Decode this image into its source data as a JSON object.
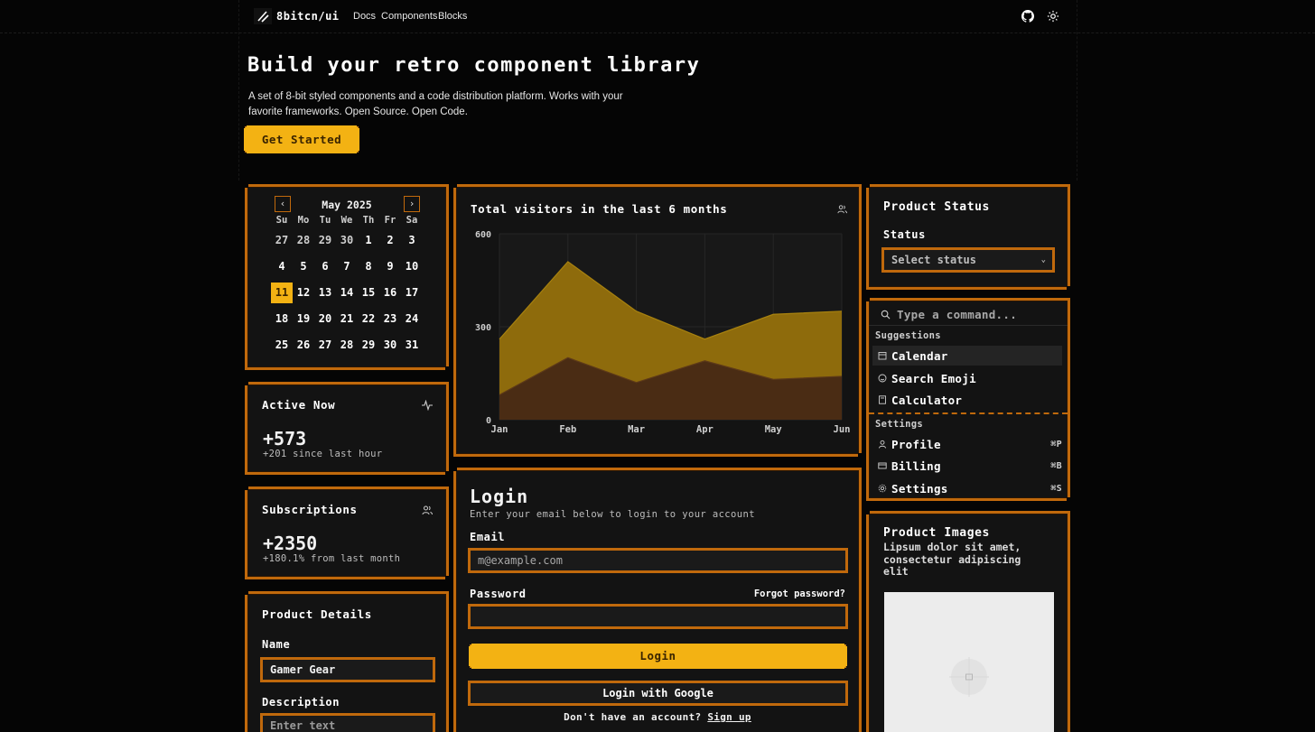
{
  "nav": {
    "brand": "8bitcn/ui",
    "links": [
      "Docs",
      "Components",
      "Blocks"
    ],
    "icons": [
      "github-icon",
      "sun-icon"
    ]
  },
  "hero": {
    "title": "Build your retro component library",
    "description": "A set of 8-bit styled components and a code distribution platform. Works with your favorite frameworks. Open Source. Open Code.",
    "cta": "Get Started"
  },
  "calendar": {
    "month_label": "May 2025",
    "prev_icon": "‹",
    "next_icon": "›",
    "weekdays": [
      "Su",
      "Mo",
      "Tu",
      "We",
      "Th",
      "Fr",
      "Sa"
    ],
    "weeks": [
      [
        "27",
        "28",
        "29",
        "30",
        "1",
        "2",
        "3"
      ],
      [
        "4",
        "5",
        "6",
        "7",
        "8",
        "9",
        "10"
      ],
      [
        "11",
        "12",
        "13",
        "14",
        "15",
        "16",
        "17"
      ],
      [
        "18",
        "19",
        "20",
        "21",
        "22",
        "23",
        "24"
      ],
      [
        "25",
        "26",
        "27",
        "28",
        "29",
        "30",
        "31"
      ]
    ],
    "selected": "11"
  },
  "active_now": {
    "title": "Active Now",
    "value": "+573",
    "sub": "+201 since last hour",
    "icon": "activity-icon"
  },
  "subscriptions": {
    "title": "Subscriptions",
    "value": "+2350",
    "sub": "+180.1% from last month",
    "icon": "users-icon"
  },
  "product_details": {
    "title": "Product Details",
    "name_label": "Name",
    "name_value": "Gamer Gear",
    "description_label": "Description",
    "description_placeholder": "Enter text"
  },
  "visitors_chart": {
    "title": "Total visitors in the last 6 months",
    "icon": "users-icon"
  },
  "chart_data": {
    "type": "area",
    "title": "Total visitors in the last 6 months",
    "categories": [
      "Jan",
      "Feb",
      "Mar",
      "Apr",
      "May",
      "Jun"
    ],
    "series": [
      {
        "values": [
          80,
          200,
          120,
          190,
          130,
          140
        ]
      },
      {
        "values": [
          260,
          510,
          350,
          260,
          340,
          350
        ]
      }
    ],
    "ylim": [
      0,
      600
    ],
    "yticks": [
      "0",
      "300",
      "600"
    ],
    "grid": true,
    "colors": [
      "#4a2c14",
      "#8e6b0c"
    ]
  },
  "login": {
    "title": "Login",
    "subtitle": "Enter your email below to login to your account",
    "email_label": "Email",
    "email_placeholder": "m@example.com",
    "password_label": "Password",
    "forgot": "Forgot password?",
    "login_button": "Login",
    "google_button": "Login with Google",
    "no_account": "Don't have an account?",
    "signup": "Sign up"
  },
  "product_status": {
    "title": "Product Status",
    "status_label": "Status",
    "select_placeholder": "Select status"
  },
  "command": {
    "placeholder": "Type a command...",
    "suggestions_heading": "Suggestions",
    "suggestions": [
      {
        "label": "Calendar",
        "icon": "calendar-icon"
      },
      {
        "label": "Search Emoji",
        "icon": "smile-icon"
      },
      {
        "label": "Calculator",
        "icon": "calculator-icon"
      }
    ],
    "settings_heading": "Settings",
    "settings": [
      {
        "label": "Profile",
        "icon": "user-icon",
        "shortcut": "⌘P"
      },
      {
        "label": "Billing",
        "icon": "credit-card-icon",
        "shortcut": "⌘B"
      },
      {
        "label": "Settings",
        "icon": "gear-icon",
        "shortcut": "⌘S"
      }
    ]
  },
  "product_images": {
    "title": "Product Images",
    "description": "Lipsum dolor sit amet, consectetur adipiscing elit"
  },
  "colors": {
    "accent": "#f3b213",
    "border": "#c0690c",
    "card_bg": "#131313",
    "page_bg": "#050505"
  }
}
